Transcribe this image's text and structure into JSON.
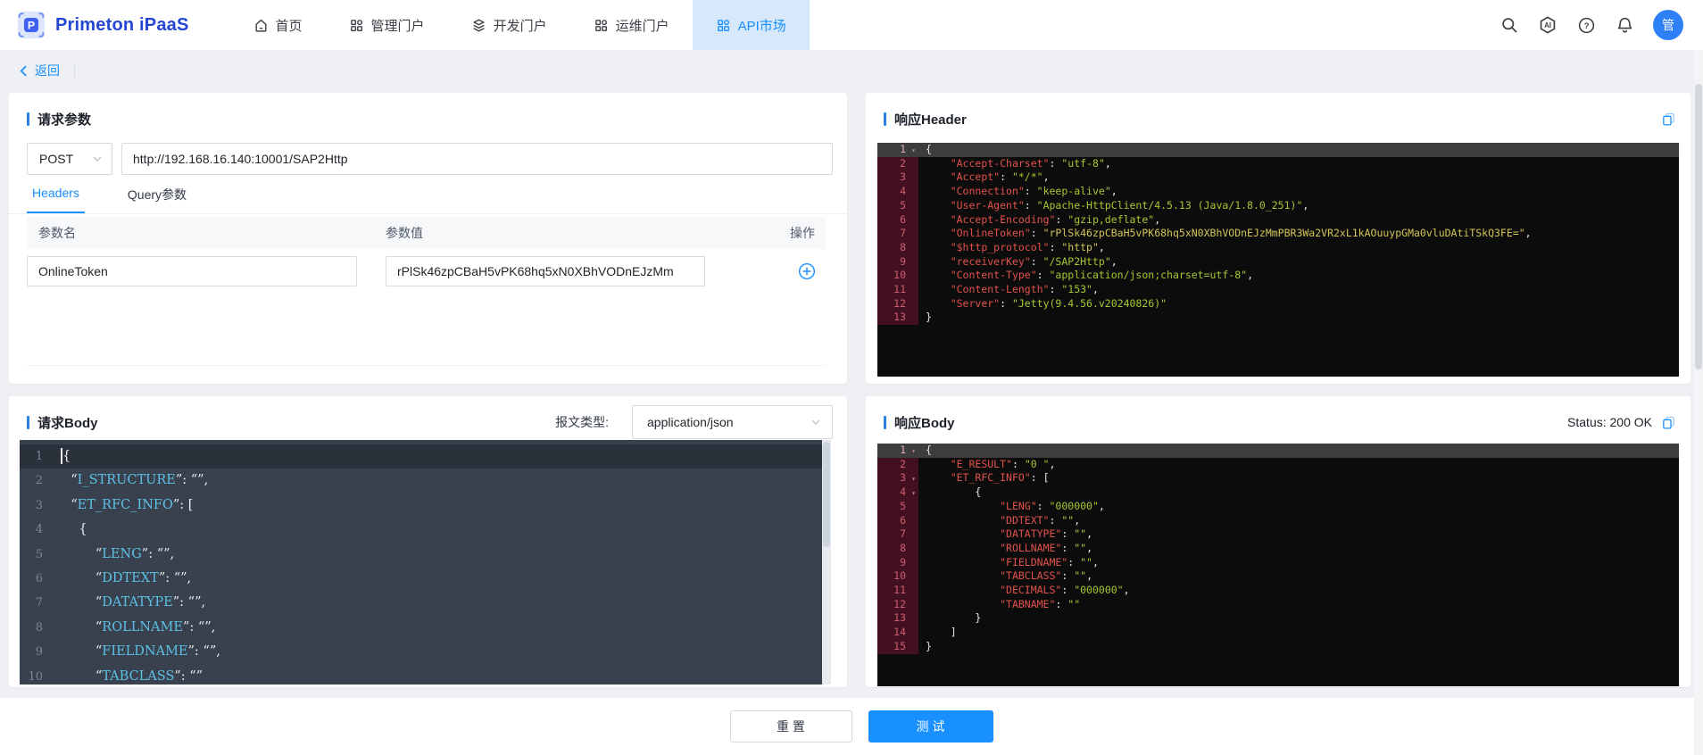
{
  "brand": {
    "name": "Primeton iPaaS"
  },
  "nav": {
    "items": [
      {
        "label": "首页",
        "icon": "home-icon"
      },
      {
        "label": "管理门户",
        "icon": "grid-icon"
      },
      {
        "label": "开发门户",
        "icon": "layers-icon"
      },
      {
        "label": "运维门户",
        "icon": "grid-icon"
      },
      {
        "label": "API市场",
        "icon": "grid-icon",
        "active": true
      }
    ],
    "avatar_text": "管"
  },
  "back": {
    "label": "返回"
  },
  "request_params": {
    "title": "请求参数",
    "method": "POST",
    "url": "http://192.168.16.140:10001/SAP2Http",
    "tabs": [
      {
        "label": "Headers",
        "active": true
      },
      {
        "label": "Query参数",
        "active": false
      }
    ],
    "columns": {
      "name": "参数名",
      "value": "参数值",
      "ops": "操作"
    },
    "rows": [
      {
        "name": "OnlineToken",
        "value": "rPlSk46zpCBaH5vPK68hq5xN0XBhVODnEJzMm"
      }
    ]
  },
  "response_header": {
    "title": "响应Header",
    "lines": [
      {
        "n": 1,
        "f": 1,
        "a": 1,
        "t": [
          [
            "{",
            "p"
          ]
        ]
      },
      {
        "n": 2,
        "t": [
          [
            "    ",
            "p"
          ],
          [
            "\"Accept-Charset\"",
            "k"
          ],
          [
            ": ",
            "p"
          ],
          [
            "\"utf-8\"",
            "g"
          ],
          [
            ",",
            "p"
          ]
        ]
      },
      {
        "n": 3,
        "t": [
          [
            "    ",
            "p"
          ],
          [
            "\"Accept\"",
            "k"
          ],
          [
            ": ",
            "p"
          ],
          [
            "\"*/*\"",
            "g"
          ],
          [
            ",",
            "p"
          ]
        ]
      },
      {
        "n": 4,
        "t": [
          [
            "    ",
            "p"
          ],
          [
            "\"Connection\"",
            "k"
          ],
          [
            ": ",
            "p"
          ],
          [
            "\"keep-alive\"",
            "g"
          ],
          [
            ",",
            "p"
          ]
        ]
      },
      {
        "n": 5,
        "t": [
          [
            "    ",
            "p"
          ],
          [
            "\"User-Agent\"",
            "k"
          ],
          [
            ": ",
            "p"
          ],
          [
            "\"Apache-HttpClient/4.5.13 (Java/1.8.0_251)\"",
            "g"
          ],
          [
            ",",
            "p"
          ]
        ]
      },
      {
        "n": 6,
        "t": [
          [
            "    ",
            "p"
          ],
          [
            "\"Accept-Encoding\"",
            "k"
          ],
          [
            ": ",
            "p"
          ],
          [
            "\"gzip,deflate\"",
            "g"
          ],
          [
            ",",
            "p"
          ]
        ]
      },
      {
        "n": 7,
        "t": [
          [
            "    ",
            "p"
          ],
          [
            "\"OnlineToken\"",
            "k"
          ],
          [
            ": ",
            "p"
          ],
          [
            "\"rPlSk46zpCBaH5vPK68hq5xN0XBhVODnEJzMmPBR3Wa2VR2xL1kAOuuypGMa0vluDAtiTSkQ3FE=\"",
            "y"
          ],
          [
            ",",
            "p"
          ]
        ]
      },
      {
        "n": 8,
        "t": [
          [
            "    ",
            "p"
          ],
          [
            "\"$http_protocol\"",
            "k"
          ],
          [
            ": ",
            "p"
          ],
          [
            "\"http\"",
            "y"
          ],
          [
            ",",
            "p"
          ]
        ]
      },
      {
        "n": 9,
        "t": [
          [
            "    ",
            "p"
          ],
          [
            "\"receiverKey\"",
            "k"
          ],
          [
            ": ",
            "p"
          ],
          [
            "\"/SAP2Http\"",
            "g"
          ],
          [
            ",",
            "p"
          ]
        ]
      },
      {
        "n": 10,
        "t": [
          [
            "    ",
            "p"
          ],
          [
            "\"Content-Type\"",
            "k"
          ],
          [
            ": ",
            "p"
          ],
          [
            "\"application/json;charset=utf-8\"",
            "g"
          ],
          [
            ",",
            "p"
          ]
        ]
      },
      {
        "n": 11,
        "t": [
          [
            "    ",
            "p"
          ],
          [
            "\"Content-Length\"",
            "k"
          ],
          [
            ": ",
            "p"
          ],
          [
            "\"153\"",
            "g"
          ],
          [
            ",",
            "p"
          ]
        ]
      },
      {
        "n": 12,
        "t": [
          [
            "    ",
            "p"
          ],
          [
            "\"Server\"",
            "k"
          ],
          [
            ": ",
            "p"
          ],
          [
            "\"Jetty(9.4.56.v20240826)\"",
            "g"
          ]
        ]
      },
      {
        "n": 13,
        "t": [
          [
            "}",
            "p"
          ]
        ]
      }
    ]
  },
  "request_body": {
    "title": "请求Body",
    "content_type_label": "报文类型:",
    "content_type": "application/json",
    "lines": [
      {
        "n": 1,
        "a": 1,
        "t": [
          [
            "{",
            "p"
          ]
        ]
      },
      {
        "n": 2,
        "t": [
          [
            "  “",
            "p"
          ],
          [
            "I_STRUCTURE",
            "c"
          ],
          [
            "”: “”,",
            "p"
          ]
        ]
      },
      {
        "n": 3,
        "t": [
          [
            "  “",
            "p"
          ],
          [
            "ET_RFC_INFO",
            "c"
          ],
          [
            "”: [",
            "p"
          ]
        ]
      },
      {
        "n": 4,
        "t": [
          [
            "    {",
            "p"
          ]
        ]
      },
      {
        "n": 5,
        "t": [
          [
            "        “",
            "p"
          ],
          [
            "LENG",
            "c"
          ],
          [
            "”: “”,",
            "p"
          ]
        ]
      },
      {
        "n": 6,
        "t": [
          [
            "        “",
            "p"
          ],
          [
            "DDTEXT",
            "c"
          ],
          [
            "”: “”,",
            "p"
          ]
        ]
      },
      {
        "n": 7,
        "t": [
          [
            "        “",
            "p"
          ],
          [
            "DATATYPE",
            "c"
          ],
          [
            "”: “”,",
            "p"
          ]
        ]
      },
      {
        "n": 8,
        "t": [
          [
            "        “",
            "p"
          ],
          [
            "ROLLNAME",
            "c"
          ],
          [
            "”: “”,",
            "p"
          ]
        ]
      },
      {
        "n": 9,
        "t": [
          [
            "        “",
            "p"
          ],
          [
            "FIELDNAME",
            "c"
          ],
          [
            "”: “”,",
            "p"
          ]
        ]
      },
      {
        "n": 10,
        "t": [
          [
            "        “",
            "p"
          ],
          [
            "TABCLASS",
            "c"
          ],
          [
            "”: “”",
            "p"
          ]
        ]
      }
    ]
  },
  "response_body": {
    "title": "响应Body",
    "status": "Status: 200 OK",
    "lines": [
      {
        "n": 1,
        "f": 1,
        "a": 1,
        "t": [
          [
            "{",
            "p"
          ]
        ]
      },
      {
        "n": 2,
        "t": [
          [
            "    ",
            "p"
          ],
          [
            "\"E_RESULT\"",
            "k"
          ],
          [
            ": ",
            "p"
          ],
          [
            "\"0 \"",
            "g"
          ],
          [
            ",",
            "p"
          ]
        ]
      },
      {
        "n": 3,
        "f": 1,
        "t": [
          [
            "    ",
            "p"
          ],
          [
            "\"ET_RFC_INFO\"",
            "k"
          ],
          [
            ": [",
            "p"
          ]
        ]
      },
      {
        "n": 4,
        "f": 1,
        "t": [
          [
            "        {",
            "p"
          ]
        ]
      },
      {
        "n": 5,
        "t": [
          [
            "            ",
            "p"
          ],
          [
            "\"LENG\"",
            "k"
          ],
          [
            ": ",
            "p"
          ],
          [
            "\"000000\"",
            "g"
          ],
          [
            ",",
            "p"
          ]
        ]
      },
      {
        "n": 6,
        "t": [
          [
            "            ",
            "p"
          ],
          [
            "\"DDTEXT\"",
            "k"
          ],
          [
            ": ",
            "p"
          ],
          [
            "\"\"",
            "g"
          ],
          [
            ",",
            "p"
          ]
        ]
      },
      {
        "n": 7,
        "t": [
          [
            "            ",
            "p"
          ],
          [
            "\"DATATYPE\"",
            "k"
          ],
          [
            ": ",
            "p"
          ],
          [
            "\"\"",
            "g"
          ],
          [
            ",",
            "p"
          ]
        ]
      },
      {
        "n": 8,
        "t": [
          [
            "            ",
            "p"
          ],
          [
            "\"ROLLNAME\"",
            "k"
          ],
          [
            ": ",
            "p"
          ],
          [
            "\"\"",
            "g"
          ],
          [
            ",",
            "p"
          ]
        ]
      },
      {
        "n": 9,
        "t": [
          [
            "            ",
            "p"
          ],
          [
            "\"FIELDNAME\"",
            "k"
          ],
          [
            ": ",
            "p"
          ],
          [
            "\"\"",
            "g"
          ],
          [
            ",",
            "p"
          ]
        ]
      },
      {
        "n": 10,
        "t": [
          [
            "            ",
            "p"
          ],
          [
            "\"TABCLASS\"",
            "k"
          ],
          [
            ": ",
            "p"
          ],
          [
            "\"\"",
            "g"
          ],
          [
            ",",
            "p"
          ]
        ]
      },
      {
        "n": 11,
        "t": [
          [
            "            ",
            "p"
          ],
          [
            "\"DECIMALS\"",
            "k"
          ],
          [
            ": ",
            "p"
          ],
          [
            "\"000000\"",
            "g"
          ],
          [
            ",",
            "p"
          ]
        ]
      },
      {
        "n": 12,
        "t": [
          [
            "            ",
            "p"
          ],
          [
            "\"TABNAME\"",
            "k"
          ],
          [
            ": ",
            "p"
          ],
          [
            "\"\"",
            "g"
          ]
        ]
      },
      {
        "n": 13,
        "t": [
          [
            "        }",
            "p"
          ]
        ]
      },
      {
        "n": 14,
        "t": [
          [
            "    ]",
            "p"
          ]
        ]
      },
      {
        "n": 15,
        "t": [
          [
            "}",
            "p"
          ]
        ]
      }
    ]
  },
  "footer": {
    "reset": "重 置",
    "test": "测 试"
  },
  "colors": {
    "primary": "#1890ff",
    "brand_blue": "#2446d4",
    "nav_active_bg": "#d7e8fa",
    "code_dark_bg": "#0c0c0c",
    "code_gutter_bg": "#431022",
    "line_number": "#ce5f6e",
    "json_key_red": "#e2524c",
    "json_string_green": "#a6c832",
    "json_string_yellow": "#d3c559",
    "code_slate_bg": "#38414d",
    "slate_key_cyan": "#5cc1e6"
  }
}
